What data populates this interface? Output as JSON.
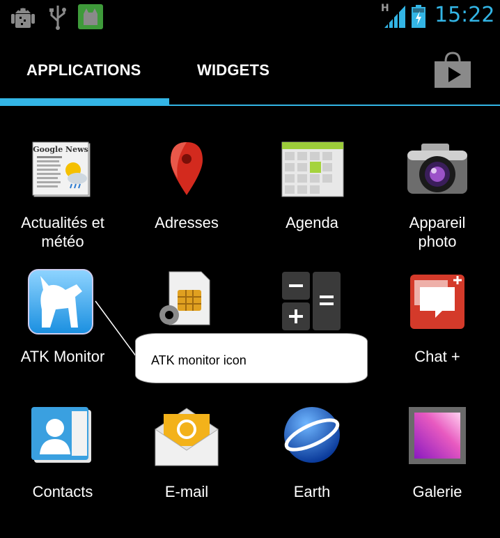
{
  "status_bar": {
    "icons": [
      "android-debug-icon",
      "usb-icon",
      "app-notification-icon",
      "signal-icon",
      "battery-icon"
    ],
    "network_type": "H",
    "time": "15:22"
  },
  "tabs": [
    {
      "label": "APPLICATIONS",
      "selected": true
    },
    {
      "label": "WIDGETS",
      "selected": false
    }
  ],
  "store_icon": "play-store-icon",
  "accent_color": "#33b5e5",
  "apps": [
    {
      "label": "Actualités et\nmétéo",
      "icon": "news-weather-icon"
    },
    {
      "label": "Adresses",
      "icon": "maps-pin-icon"
    },
    {
      "label": "Agenda",
      "icon": "calendar-icon"
    },
    {
      "label": "Appareil\nphoto",
      "icon": "camera-icon"
    },
    {
      "label": "ATK Monitor",
      "icon": "atk-monitor-cat-icon"
    },
    {
      "label": "",
      "icon": "sim-toolkit-icon"
    },
    {
      "label": "",
      "icon": "calculator-icon"
    },
    {
      "label": "Chat +",
      "icon": "chat-plus-icon"
    },
    {
      "label": "Contacts",
      "icon": "contacts-icon"
    },
    {
      "label": "E-mail",
      "icon": "email-icon"
    },
    {
      "label": "Earth",
      "icon": "earth-globe-icon"
    },
    {
      "label": "Galerie",
      "icon": "gallery-icon"
    }
  ],
  "callout": {
    "text": "ATK monitor icon"
  }
}
